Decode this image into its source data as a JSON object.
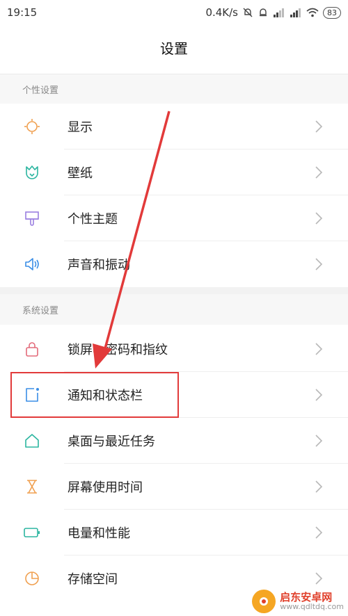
{
  "status_bar": {
    "time": "19:15",
    "speed": "0.4K/s",
    "battery": "83"
  },
  "page_title": "设置",
  "sections": [
    {
      "header": "个性设置",
      "items": [
        {
          "label": "显示",
          "icon": "sun-icon",
          "color": "#f0a050"
        },
        {
          "label": "壁纸",
          "icon": "tulip-icon",
          "color": "#2bb5a0"
        },
        {
          "label": "个性主题",
          "icon": "brush-icon",
          "color": "#9a7fe0"
        },
        {
          "label": "声音和振动",
          "icon": "speaker-icon",
          "color": "#3a8ee6"
        }
      ]
    },
    {
      "header": "系统设置",
      "items": [
        {
          "label": "锁屏、密码和指纹",
          "icon": "lock-icon",
          "color": "#e36a7a"
        },
        {
          "label": "通知和状态栏",
          "icon": "notification-icon",
          "color": "#3a8ee6"
        },
        {
          "label": "桌面与最近任务",
          "icon": "home-icon",
          "color": "#2bb5a0"
        },
        {
          "label": "屏幕使用时间",
          "icon": "hourglass-icon",
          "color": "#f0a050"
        },
        {
          "label": "电量和性能",
          "icon": "battery-icon",
          "color": "#2bb5a0"
        },
        {
          "label": "存储空间",
          "icon": "pie-chart-icon",
          "color": "#f0a050"
        }
      ]
    }
  ],
  "watermark": {
    "name": "启东安卓网",
    "url": "www.qdltdq.com"
  },
  "colors": {
    "highlight": "#e23a3a",
    "divider": "#eeeeee",
    "section_bg": "#f7f7f7"
  }
}
